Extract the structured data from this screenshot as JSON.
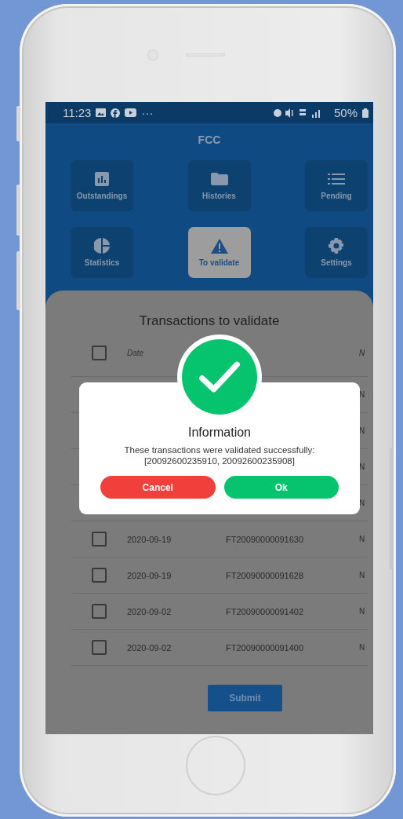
{
  "status_bar": {
    "time": "11:23",
    "more": "···",
    "battery": "50%"
  },
  "app_bar": {
    "title": "FCC"
  },
  "menu": [
    {
      "label": "Outstandings",
      "selected": false
    },
    {
      "label": "Histories",
      "selected": false
    },
    {
      "label": "Pending",
      "selected": false
    },
    {
      "label": "Statistics",
      "selected": false
    },
    {
      "label": "To validate",
      "selected": true
    },
    {
      "label": "Settings",
      "selected": false
    }
  ],
  "sheet": {
    "title": "Transactions to validate",
    "header": {
      "checked": false,
      "date": "Date",
      "column_3": "N"
    },
    "rows": [
      {
        "column_3": "N"
      },
      {
        "column_3": "N"
      },
      {
        "column_3": "N"
      },
      {
        "column_3": "N"
      },
      {
        "checked": false,
        "date": "2020-09-19",
        "reference": "FT20090000091630",
        "column_3": "N"
      },
      {
        "checked": false,
        "date": "2020-09-19",
        "reference": "FT20090000091628",
        "column_3": "N"
      },
      {
        "checked": false,
        "date": "2020-09-02",
        "reference": "FT20090000091402",
        "column_3": "N"
      },
      {
        "checked": false,
        "date": "2020-09-02",
        "reference": "FT20090000091400",
        "column_3": "N"
      }
    ],
    "submit": "Submit"
  },
  "dialog": {
    "title": "Information",
    "message": "These transactions were validated successfully:\n[20092600235910, 20092600235908]",
    "buttons": [
      {
        "label": "Cancel",
        "kind": "cancel"
      },
      {
        "label": "Ok",
        "kind": "confirm"
      }
    ]
  }
}
